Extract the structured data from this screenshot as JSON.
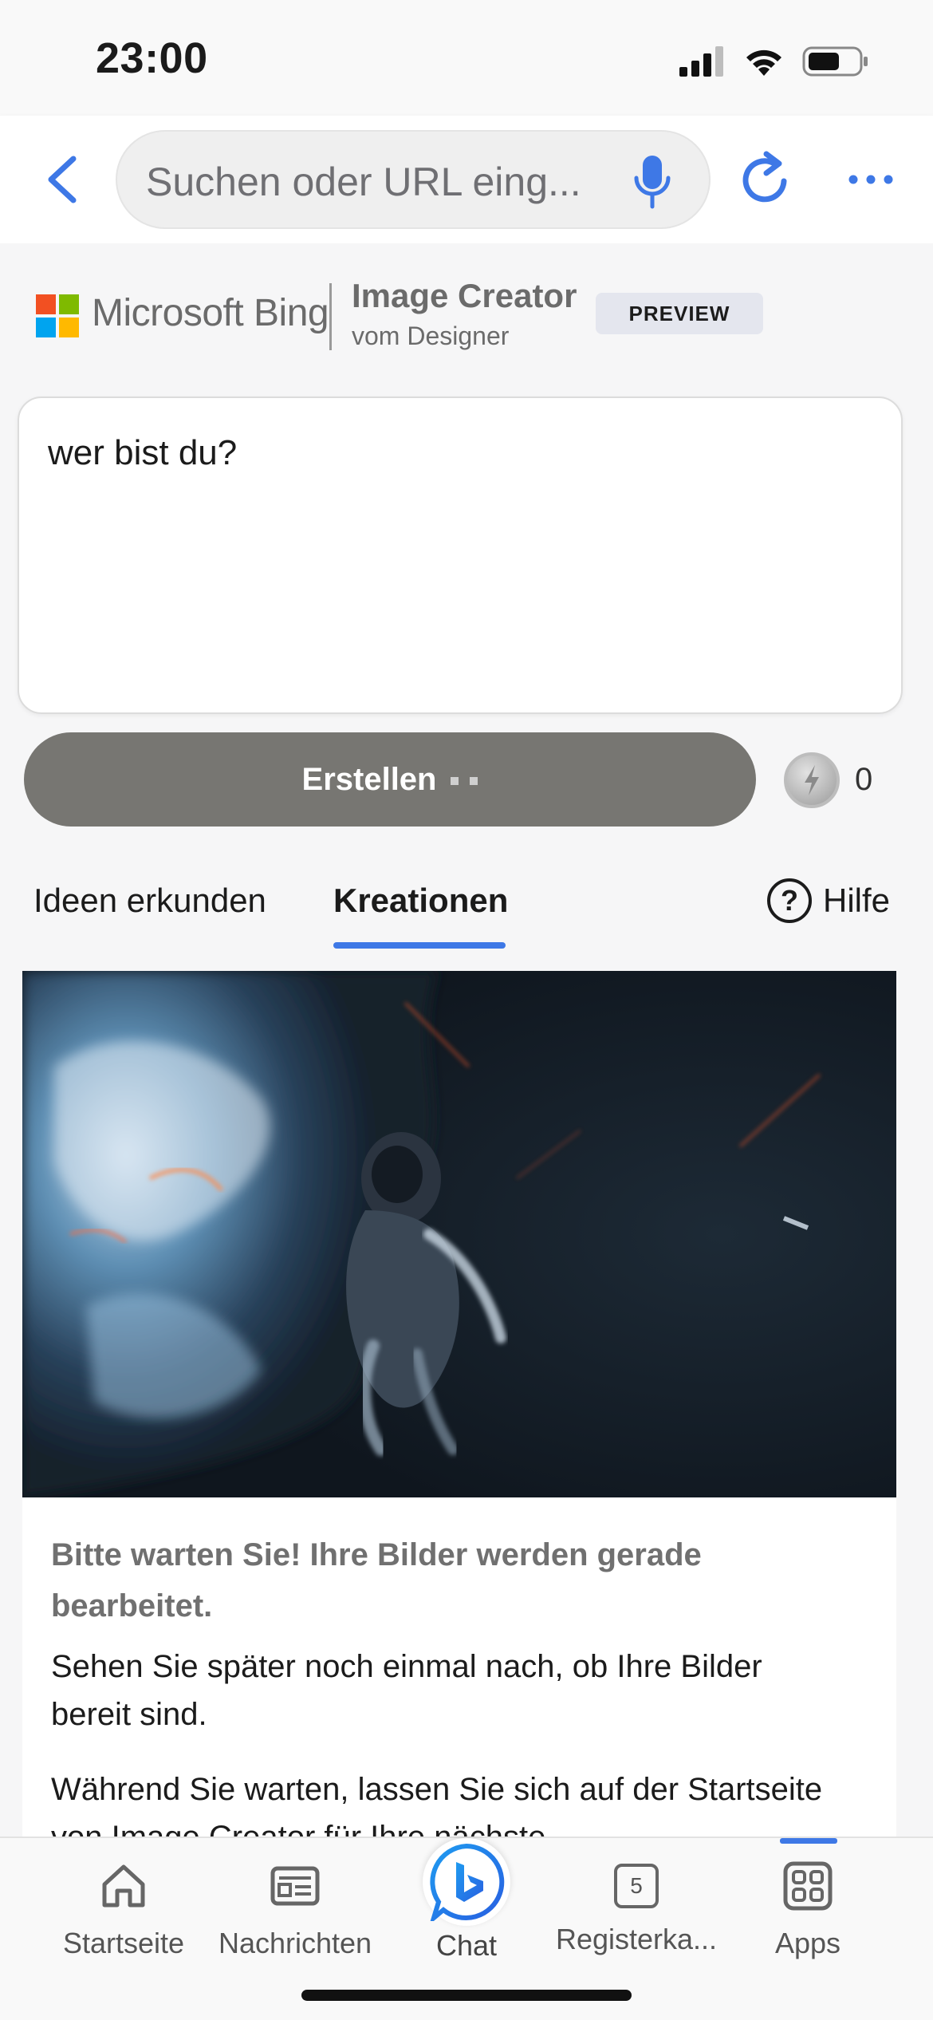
{
  "status_bar": {
    "time": "23:00"
  },
  "browser": {
    "search_placeholder": "Suchen oder URL eing...",
    "accent_color": "#3e78e6"
  },
  "brand": {
    "company": "Microsoft Bing",
    "product": "Image Creator",
    "product_subtitle": "vom Designer",
    "badge": "PREVIEW"
  },
  "prompt": {
    "value": "wer bist du?"
  },
  "create": {
    "button_label": "Erstellen",
    "boost_count": "0"
  },
  "tabs": {
    "ideas": "Ideen erkunden",
    "creations": "Kreationen",
    "help": "Hilfe",
    "active": "creations"
  },
  "card": {
    "title": "Bitte warten Sie! Ihre Bilder werden gerade bearbeitet.",
    "body1": "Sehen Sie später noch einmal nach, ob Ihre Bilder bereit sind.",
    "body2": "Während Sie warten, lassen Sie sich auf der Startseite von Image Creator für Ihre nächste"
  },
  "bottom_nav": {
    "items": [
      {
        "label": "Startseite",
        "icon": "home-icon"
      },
      {
        "label": "Nachrichten",
        "icon": "news-icon"
      },
      {
        "label": "Chat",
        "icon": "bing-chat-icon"
      },
      {
        "label": "Registerka...",
        "icon": "tabs-icon",
        "count": "5"
      },
      {
        "label": "Apps",
        "icon": "apps-grid-icon"
      }
    ]
  }
}
